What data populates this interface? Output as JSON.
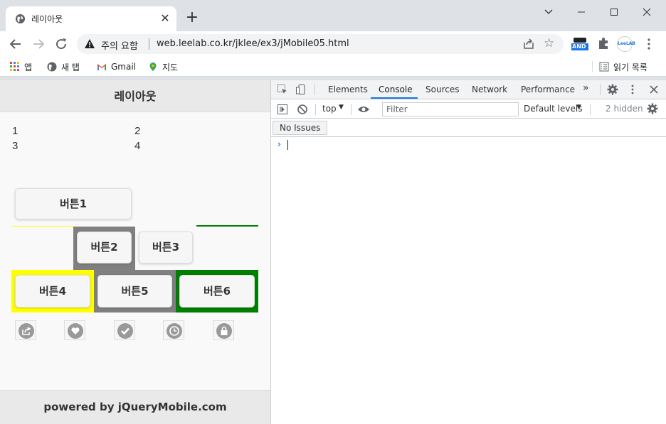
{
  "browser": {
    "tab_title": "레이아웃",
    "close_glyph": "✕",
    "newtab_glyph": "+",
    "security_label": "주의 요함",
    "url": "web.leelab.co.kr/jklee/ex3/jMobile05.html",
    "extensions": {
      "and_label": "AND",
      "leelab_label": "LeeLAB"
    },
    "bookmarks": [
      {
        "label": "앱"
      },
      {
        "label": "새 탭"
      },
      {
        "label": "Gmail"
      },
      {
        "label": "지도"
      }
    ],
    "reading_list_label": "읽기 목록"
  },
  "page": {
    "header_title": "레이아웃",
    "grid": [
      "1",
      "2",
      "3",
      "4"
    ],
    "buttons": {
      "b1": "버튼1",
      "b2": "버튼2",
      "b3": "버튼3",
      "b4": "버튼4",
      "b5": "버튼5",
      "b6": "버튼6"
    },
    "icon_buttons": [
      "action-icon",
      "heart-icon",
      "check-icon",
      "clock-icon",
      "lock-icon"
    ],
    "footer": "powered by jQueryMobile.com",
    "colors": {
      "yellow": "#ffff00",
      "gray": "#808080",
      "green": "#008000"
    }
  },
  "devtools": {
    "tabs": [
      "Elements",
      "Console",
      "Sources",
      "Network",
      "Performance"
    ],
    "more_tabs": "»",
    "active_tab": "Console",
    "context": "top",
    "filter_placeholder": "Filter",
    "levels": "Default levels",
    "hidden": "2 hidden",
    "no_issues": "No Issues",
    "prompt": "›"
  }
}
